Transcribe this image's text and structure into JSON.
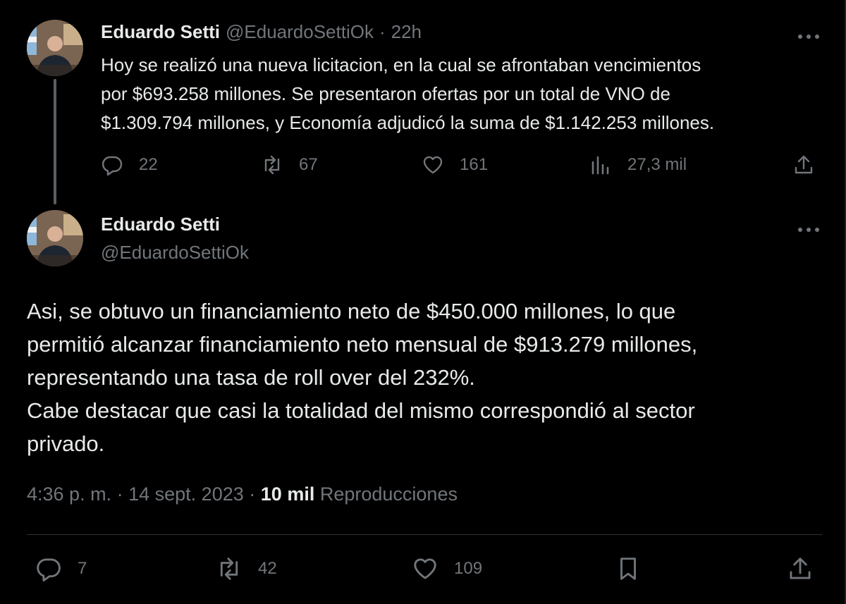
{
  "tweet1": {
    "author_name": "Eduardo Setti",
    "handle": "@EduardoSettiOk",
    "time_sep": "·",
    "time": "22h",
    "lines": [
      "Hoy se realizó una nueva licitacion, en la cual se afrontaban vencimientos",
      "por $693.258  millones. Se presentaron ofertas por un total de VNO de",
      "$1.309.794 millones, y Economía adjudicó  la suma de $1.142.253 millones."
    ],
    "replies": "22",
    "reposts": "67",
    "likes": "161",
    "views": "27,3 mil"
  },
  "tweet2": {
    "author_name": "Eduardo Setti",
    "handle": "@EduardoSettiOk",
    "lines": [
      "Asi, se obtuvo un financiamiento neto de $450.000 millones, lo que",
      "permitió alcanzar financiamiento neto mensual de $913.279 millones,",
      "representando una tasa de roll over del 232%.",
      "Cabe destacar que casi la totalidad del mismo correspondió al sector",
      "privado."
    ],
    "time": "4:36 p. m.",
    "sep1": "·",
    "date": "14 sept. 2023",
    "sep2": "·",
    "views_count": "10 mil",
    "views_label": "Reproducciones",
    "replies": "7",
    "reposts": "42",
    "likes": "109"
  },
  "icons": {
    "more": "more-icon",
    "reply": "reply-icon",
    "repost": "repost-icon",
    "like": "like-icon",
    "views": "views-icon",
    "bookmark": "bookmark-icon",
    "share": "share-icon"
  },
  "colors": {
    "background": "#000000",
    "text": "#e7e9ea",
    "secondary": "#71767b",
    "divider": "#2f3336"
  }
}
